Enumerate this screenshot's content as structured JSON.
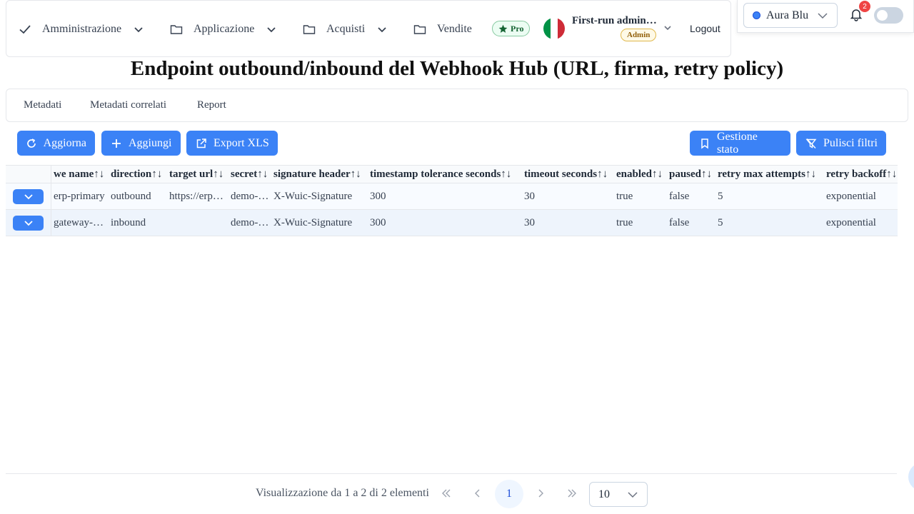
{
  "menubar": {
    "items": [
      {
        "label": "Amministrazione",
        "icon": "check-icon"
      },
      {
        "label": "Applicazione",
        "icon": "folder-icon"
      },
      {
        "label": "Acquisti",
        "icon": "folder-icon"
      },
      {
        "label": "Vendite",
        "icon": "folder-icon"
      }
    ],
    "pro_label": "Pro",
    "user_name": "First-run administrator",
    "user_role": "Admin",
    "logout_label": "Logout"
  },
  "topright": {
    "theme_value": "Aura Blu",
    "notification_count": "2"
  },
  "page": {
    "title": "Endpoint outbound/inbound del Webhook Hub (URL, firma, retry policy)"
  },
  "tabs": [
    "Metadati",
    "Metadati correlati",
    "Report"
  ],
  "toolbar": {
    "refresh_label": "Aggiorna",
    "add_label": "Aggiungi",
    "export_label": "Export XLS",
    "state_label": "Gestione stato",
    "clear_filters_label": "Pulisci filtri"
  },
  "table": {
    "sort_glyph": "↑↓",
    "columns": [
      "we name",
      "direction",
      "target url",
      "secret",
      "signature header",
      "timestamp tolerance seconds",
      "timeout seconds",
      "enabled",
      "paused",
      "retry max attempts",
      "retry backoff"
    ],
    "rows": [
      [
        "erp-primary",
        "outbound",
        "https://erp.example.com",
        "demo-secret",
        "X-Wuic-Signature",
        "300",
        "30",
        "true",
        "false",
        "5",
        "exponential"
      ],
      [
        "gateway-inbound",
        "inbound",
        "",
        "demo-secret",
        "X-Wuic-Signature",
        "300",
        "30",
        "true",
        "false",
        "5",
        "exponential"
      ]
    ]
  },
  "pagination": {
    "info": "Visualizzazione da 1 a 2 di 2 elementi",
    "current_page": "1",
    "rows_per_page": "10"
  },
  "colors": {
    "primary": "#3b82f6",
    "flag_green": "#009246",
    "flag_white": "#ffffff",
    "flag_red": "#ce2b37"
  }
}
